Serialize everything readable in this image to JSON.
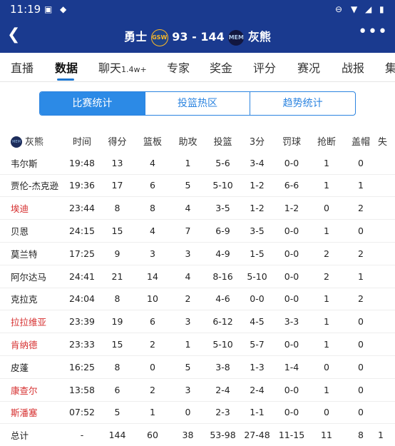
{
  "status": {
    "time": "11:19"
  },
  "nav": {
    "home_team": "勇士",
    "home_abbr": "GSW",
    "score": "93 - 144",
    "away_abbr": "MEM",
    "away_team": "灰熊"
  },
  "tabs": [
    {
      "label": "直播"
    },
    {
      "label": "数据"
    },
    {
      "label": "聊天",
      "sub": "1.4w+"
    },
    {
      "label": "专家"
    },
    {
      "label": "奖金"
    },
    {
      "label": "评分"
    },
    {
      "label": "赛况"
    },
    {
      "label": "战报"
    },
    {
      "label": "集"
    }
  ],
  "segments": [
    "比赛统计",
    "投篮热区",
    "趋势统计"
  ],
  "table": {
    "team": "灰熊",
    "headers": [
      "时间",
      "得分",
      "篮板",
      "助攻",
      "投篮",
      "3分",
      "罚球",
      "抢断",
      "盖帽",
      "失"
    ],
    "rows": [
      {
        "name": "韦尔斯",
        "red": false,
        "v": [
          "19:48",
          "13",
          "4",
          "1",
          "5-6",
          "3-4",
          "0-0",
          "1",
          "0"
        ]
      },
      {
        "name": "贾伦-杰克逊",
        "red": false,
        "v": [
          "19:36",
          "17",
          "6",
          "5",
          "5-10",
          "1-2",
          "6-6",
          "1",
          "1"
        ]
      },
      {
        "name": "埃迪",
        "red": true,
        "v": [
          "23:44",
          "8",
          "8",
          "4",
          "3-5",
          "1-2",
          "1-2",
          "0",
          "2"
        ]
      },
      {
        "name": "贝恩",
        "red": false,
        "v": [
          "24:15",
          "15",
          "4",
          "7",
          "6-9",
          "3-5",
          "0-0",
          "1",
          "0"
        ]
      },
      {
        "name": "莫兰特",
        "red": false,
        "v": [
          "17:25",
          "9",
          "3",
          "3",
          "4-9",
          "1-5",
          "0-0",
          "2",
          "2"
        ]
      },
      {
        "name": "阿尔达马",
        "red": false,
        "v": [
          "24:41",
          "21",
          "14",
          "4",
          "8-16",
          "5-10",
          "0-0",
          "2",
          "1"
        ]
      },
      {
        "name": "克拉克",
        "red": false,
        "v": [
          "24:04",
          "8",
          "10",
          "2",
          "4-6",
          "0-0",
          "0-0",
          "1",
          "2"
        ]
      },
      {
        "name": "拉拉维亚",
        "red": true,
        "v": [
          "23:39",
          "19",
          "6",
          "3",
          "6-12",
          "4-5",
          "3-3",
          "1",
          "0"
        ]
      },
      {
        "name": "肯纳德",
        "red": true,
        "v": [
          "23:33",
          "15",
          "2",
          "1",
          "5-10",
          "5-7",
          "0-0",
          "1",
          "0"
        ]
      },
      {
        "name": "皮蓬",
        "red": false,
        "v": [
          "16:25",
          "8",
          "0",
          "5",
          "3-8",
          "1-3",
          "1-4",
          "0",
          "0"
        ]
      },
      {
        "name": "康查尔",
        "red": true,
        "v": [
          "13:58",
          "6",
          "2",
          "3",
          "2-4",
          "2-4",
          "0-0",
          "1",
          "0"
        ]
      },
      {
        "name": "斯潘塞",
        "red": true,
        "v": [
          "07:52",
          "5",
          "1",
          "0",
          "2-3",
          "1-1",
          "0-0",
          "0",
          "0"
        ]
      }
    ],
    "total": {
      "name": "总计",
      "v": [
        "-",
        "144",
        "60",
        "38",
        "53-98",
        "27-48",
        "11-15",
        "11",
        "8",
        "1"
      ]
    }
  }
}
